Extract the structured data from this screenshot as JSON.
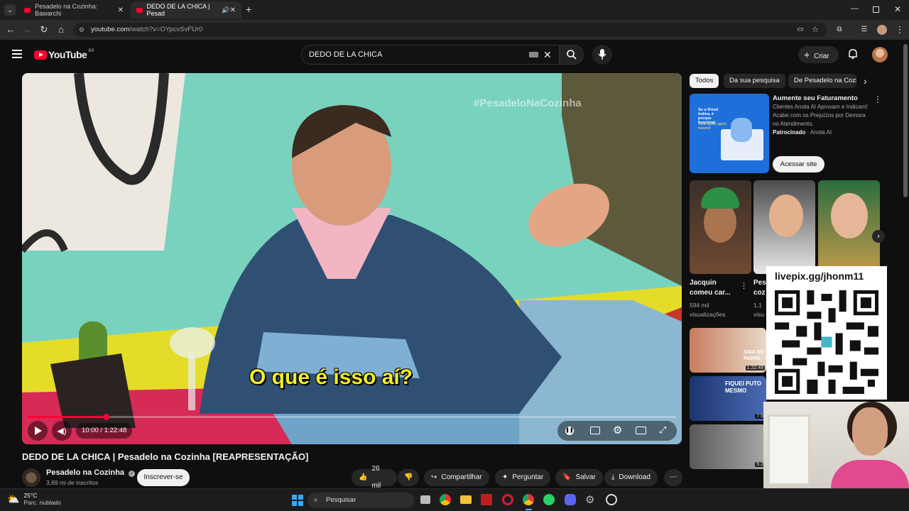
{
  "browser": {
    "tabs": [
      {
        "title": "Pesadelo na Cozinha: Bawarchi"
      },
      {
        "title": "DEDO DE LA CHICA | Pesad"
      }
    ],
    "url_host": "youtube.com",
    "url_path": "/watch?v=OYpcvSvFUr0"
  },
  "youtube": {
    "logo": "YouTube",
    "logo_region": "BR",
    "search_value": "DEDO DE LA CHICA",
    "create_label": "Criar"
  },
  "player": {
    "watermark": "#PesadeloNaCozinha",
    "subtitle": "O que é isso aí?",
    "time": "10:00 / 1:22:48",
    "progress_fraction": 0.12,
    "qr_label": "livepix.gg/jhonm11"
  },
  "video": {
    "title": "DEDO DE LA CHICA | Pesadelo na Cozinha [REAPRESENTAÇÃO]",
    "channel": "Pesadelo na Cozinha",
    "subscribers": "3,69 mi de inscritos",
    "subscribe_label": "Inscrever-se",
    "likes": "26 mil",
    "share_label": "Compartilhar",
    "ask_label": "Perguntar",
    "save_label": "Salvar",
    "download_label": "Download"
  },
  "sidebar": {
    "chips": [
      "Todos",
      "Da sua pesquisa",
      "De Pesadelo na Cozi"
    ],
    "ad": {
      "title": "Aumente seu Faturamento",
      "desc": "Clientes Anota AI Aprovam e Indicam! Acabe com os Prejuízos por Demora no Atendimento.",
      "sponsored": "Patrocinado",
      "advertiser": "Anota AI",
      "cta": "Acessar site",
      "thumb_text1": "Se o iFood indica, é porque funciona!",
      "thumb_text2": "Teste grátis agora mesmo!"
    },
    "shorts": [
      {
        "title": "Jacquin comeu car...",
        "views": "594 mil visualizações"
      },
      {
        "title": "Pes coz",
        "views": "1,1 visu"
      }
    ],
    "videos": [
      {
        "thumb_text": "SAIA DO PADRE",
        "duration": "1:22:49"
      },
      {
        "thumb_text": "FIQUEI PUTO MESMO",
        "duration": "7:5"
      },
      {
        "thumb_text": "",
        "duration": "5:2"
      }
    ]
  },
  "taskbar": {
    "weather_temp": "25°C",
    "weather_desc": "Parc. nublado",
    "search_placeholder": "Pesquisar"
  }
}
